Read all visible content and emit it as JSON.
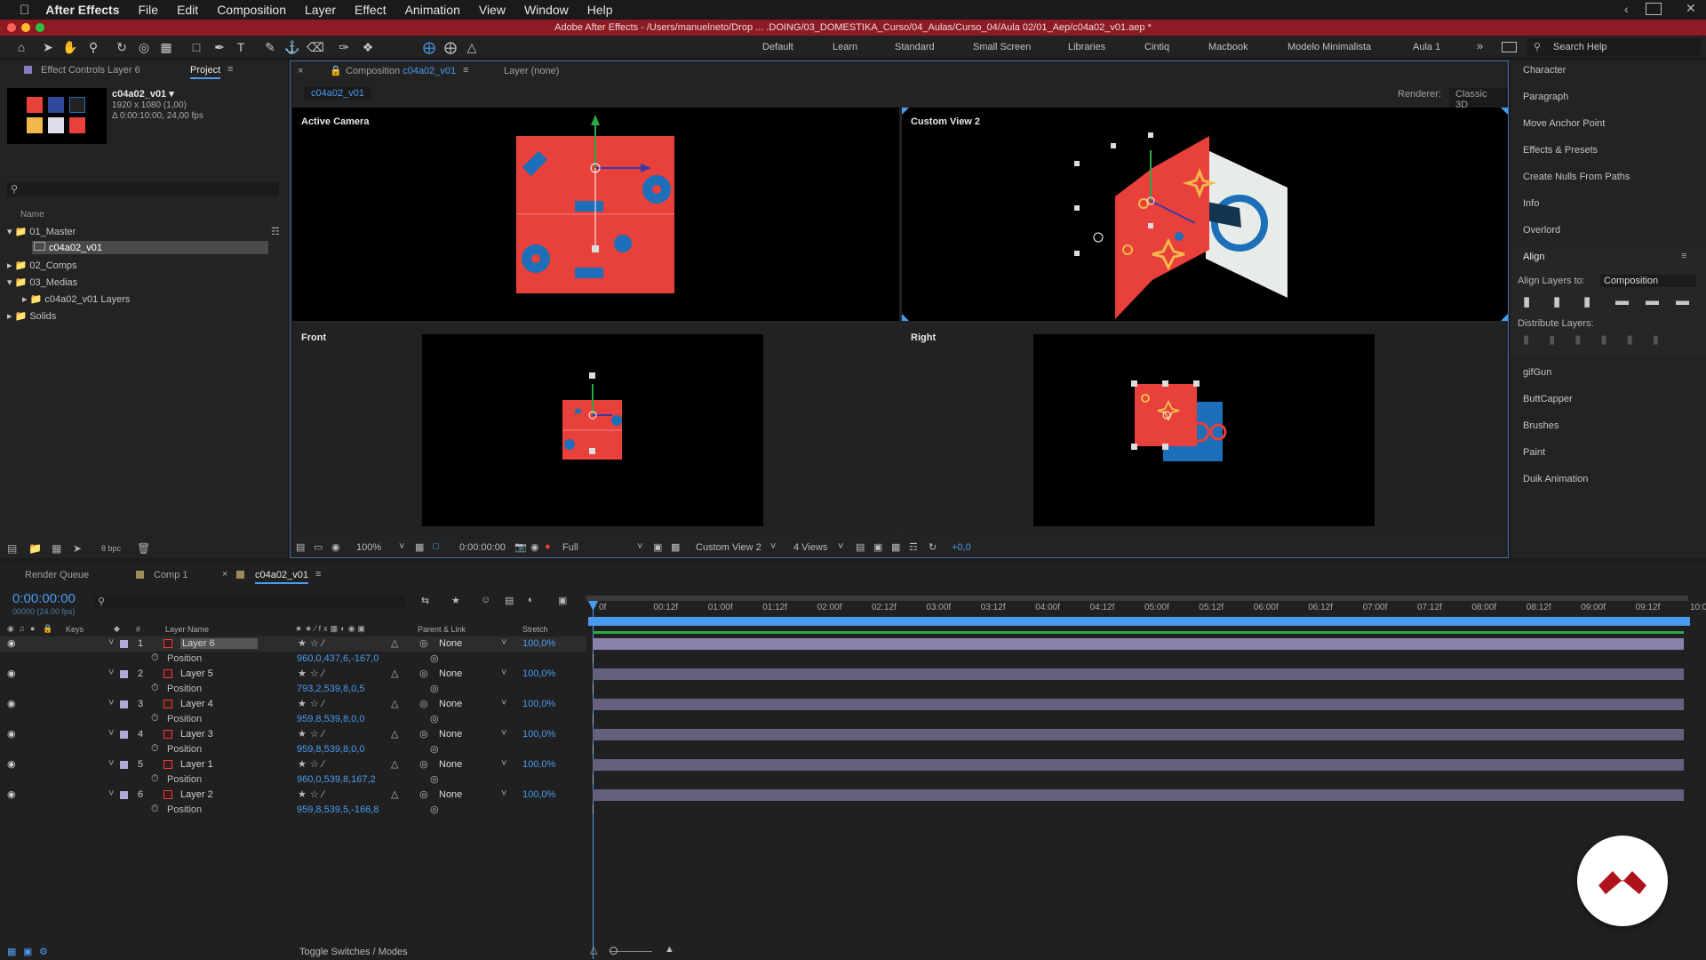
{
  "menubar": {
    "apple": "",
    "app": "After Effects",
    "items": [
      "File",
      "Edit",
      "Composition",
      "Layer",
      "Effect",
      "Animation",
      "View",
      "Window",
      "Help"
    ]
  },
  "title": "Adobe After Effects - /Users/manuelneto/Drop ... .DOING/03_DOMESTIKA_Curso/04_Aulas/Curso_04/Aula 02/01_Aep/c04a02_v01.aep *",
  "toolbar": {
    "workspaces": [
      "Default",
      "Learn",
      "Standard",
      "Small Screen",
      "Libraries",
      "Cintiq",
      "Macbook",
      "Modelo Minimalista",
      "Aula 1"
    ],
    "more": "»",
    "search_placeholder": "Search Help"
  },
  "project": {
    "tab_effect": "Effect Controls Layer 6",
    "tab_project": "Project",
    "comp_name": "c04a02_v01 ▾",
    "comp_res": "1920 x 1080 (1,00)",
    "comp_dur": "Δ 0:00:10:00, 24,00 fps",
    "col_name": "Name",
    "tree": [
      "01_Master",
      "c04a02_v01",
      "02_Comps",
      "03_Medias",
      "c04a02_v01 Layers",
      "Solids"
    ],
    "bpc": "8 bpc"
  },
  "comp": {
    "tab": "Composition",
    "tab_name": "c04a02_v01",
    "layer_tab": "Layer (none)",
    "breadcrumb": "c04a02_v01",
    "renderer_label": "Renderer:",
    "renderer": "Classic 3D",
    "views": [
      "Active Camera",
      "Custom View 2",
      "Front",
      "Right"
    ],
    "zoom": "100%",
    "timecode": "0:00:00:00",
    "resolution": "Full",
    "view_select": "Custom View 2",
    "layout_select": "4 Views",
    "exposure": "+0,0"
  },
  "right_panel": {
    "items": [
      "Character",
      "Paragraph",
      "Move Anchor Point",
      "Effects & Presets",
      "Create Nulls From Paths",
      "Info",
      "Overlord"
    ],
    "align_title": "Align",
    "align_to_label": "Align Layers to:",
    "align_to": "Composition",
    "distribute": "Distribute Layers:",
    "items2": [
      "gifGun",
      "ButtCapper",
      "Brushes",
      "Paint",
      "Duik Animation"
    ]
  },
  "timeline": {
    "tabs": [
      "Render Queue",
      "Comp 1",
      "c04a02_v01"
    ],
    "timecode": "0:00:00:00",
    "fps": "00000 (24.00 fps)",
    "cols": {
      "keys": "Keys",
      "num": "#",
      "name": "Layer Name",
      "parent": "Parent & Link",
      "stretch": "Stretch"
    },
    "ruler": [
      "0f",
      "00:12f",
      "01:00f",
      "01:12f",
      "02:00f",
      "02:12f",
      "03:00f",
      "03:12f",
      "04:00f",
      "04:12f",
      "05:00f",
      "05:12f",
      "06:00f",
      "06:12f",
      "07:00f",
      "07:12f",
      "08:00f",
      "08:12f",
      "09:00f",
      "09:12f",
      "10:0"
    ],
    "layers": [
      {
        "num": "1",
        "name": "Layer 6",
        "pos": "960,0,437,6,-167,0"
      },
      {
        "num": "2",
        "name": "Layer 5",
        "pos": "793,2,539,8,0,5"
      },
      {
        "num": "3",
        "name": "Layer 4",
        "pos": "959,8,539,8,0,0"
      },
      {
        "num": "4",
        "name": "Layer 3",
        "pos": "959,8,539,8,0,0"
      },
      {
        "num": "5",
        "name": "Layer 1",
        "pos": "960,0,539,8,167,2"
      },
      {
        "num": "6",
        "name": "Layer 2",
        "pos": "959,8,539,5,-166,8"
      }
    ],
    "prop": "Position",
    "parent": "None",
    "stretch": "100,0%",
    "toggle": "Toggle Switches / Modes"
  },
  "colors": {
    "accent": "#4a9bf0",
    "title_bar": "#8c1b24",
    "red_card": "#e8403a",
    "blue": "#1c6fb8",
    "logo": "#b0121b"
  }
}
